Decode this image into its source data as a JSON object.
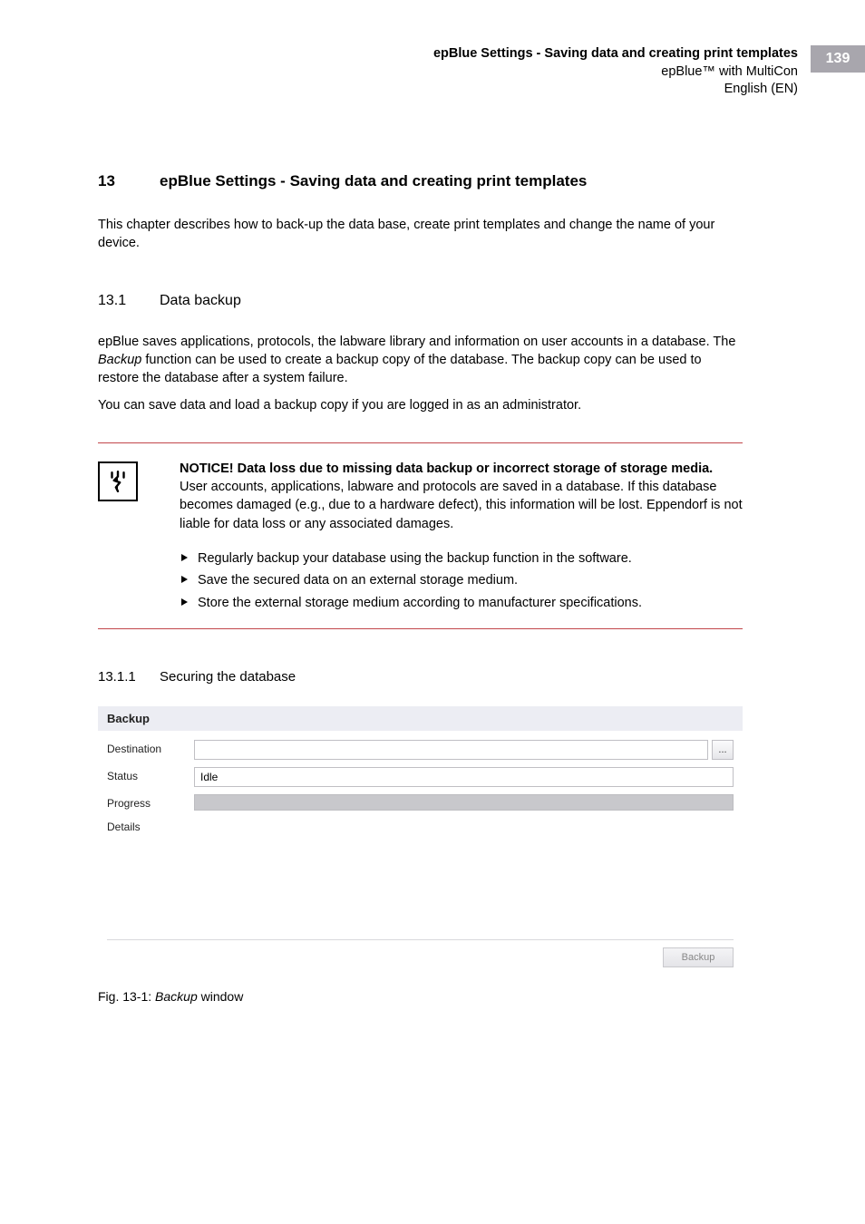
{
  "header": {
    "title_bold": "epBlue Settings - Saving data and creating print templates",
    "subtitle": "epBlue™ with MultiCon",
    "lang": "English (EN)",
    "page_number": "139"
  },
  "chapter": {
    "number": "13",
    "title": "epBlue Settings - Saving data and creating print templates",
    "intro": "This chapter describes how to back-up the data base, create print templates and change the name of your device."
  },
  "section_13_1": {
    "number": "13.1",
    "title": "Data backup",
    "para1_pre": "epBlue saves applications, protocols, the labware library and information on user accounts in a database. The ",
    "para1_italic": "Backup",
    "para1_post": " function can be used to create a backup copy of the database. The backup copy can be used to restore the database after a system failure.",
    "para2": "You can save data and load a backup copy if you are logged in as an administrator."
  },
  "notice": {
    "heading": "NOTICE! Data loss due to missing data backup or incorrect storage of storage media.",
    "body": "User accounts, applications, labware and protocols are saved in a database. If this database becomes damaged (e.g., due to a hardware defect), this information will be lost. Eppendorf is not liable for data loss or any associated damages.",
    "bullets": [
      "Regularly backup your database using the backup function in the software.",
      "Save the secured data on an external storage medium.",
      "Store the external storage medium according to manufacturer specifications."
    ]
  },
  "section_13_1_1": {
    "number": "13.1.1",
    "title": "Securing the database"
  },
  "screenshot": {
    "window_title": "Backup",
    "labels": {
      "destination": "Destination",
      "status": "Status",
      "progress": "Progress",
      "details": "Details"
    },
    "destination_value": "",
    "browse_label": "...",
    "status_value": "Idle",
    "backup_button": "Backup"
  },
  "figure_caption": {
    "prefix": "Fig. 13-1:  ",
    "italic": "Backup",
    "suffix": " window"
  }
}
